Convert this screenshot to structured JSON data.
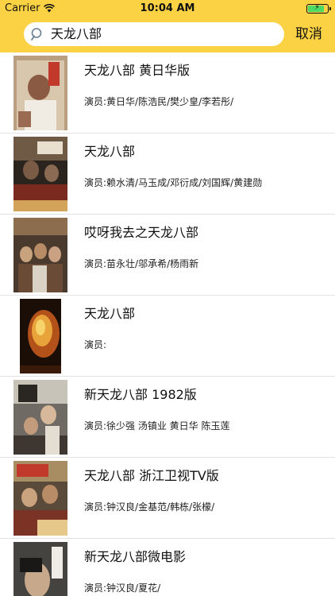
{
  "status_bar": {
    "carrier": "Carrier",
    "time": "10:04 AM",
    "battery_level": 0.85
  },
  "search": {
    "value": "天龙八部",
    "cancel_label": "取消"
  },
  "colors": {
    "header_bg": "#fcd245",
    "battery_fill": "#4cd964"
  },
  "results": [
    {
      "title": "天龙八部 黄日华版",
      "cast": "演员:黄日华/陈浩民/樊少皇/李若彤/"
    },
    {
      "title": "天龙八部",
      "cast": "演员:赖水清/马玉成/邓衍成/刘国辉/黄建勋"
    },
    {
      "title": "哎呀我去之天龙八部",
      "cast": "演员:苗永壮/邬承希/杨雨新"
    },
    {
      "title": "天龙八部",
      "cast": "演员:"
    },
    {
      "title": "新天龙八部 1982版",
      "cast": "演员:徐少强 汤镇业 黄日华 陈玉莲"
    },
    {
      "title": "天龙八部 浙江卫视TV版",
      "cast": "演员:钟汉良/金基范/韩栋/张檬/"
    },
    {
      "title": "新天龙八部微电影",
      "cast": "演员:钟汉良/夏花/"
    }
  ]
}
